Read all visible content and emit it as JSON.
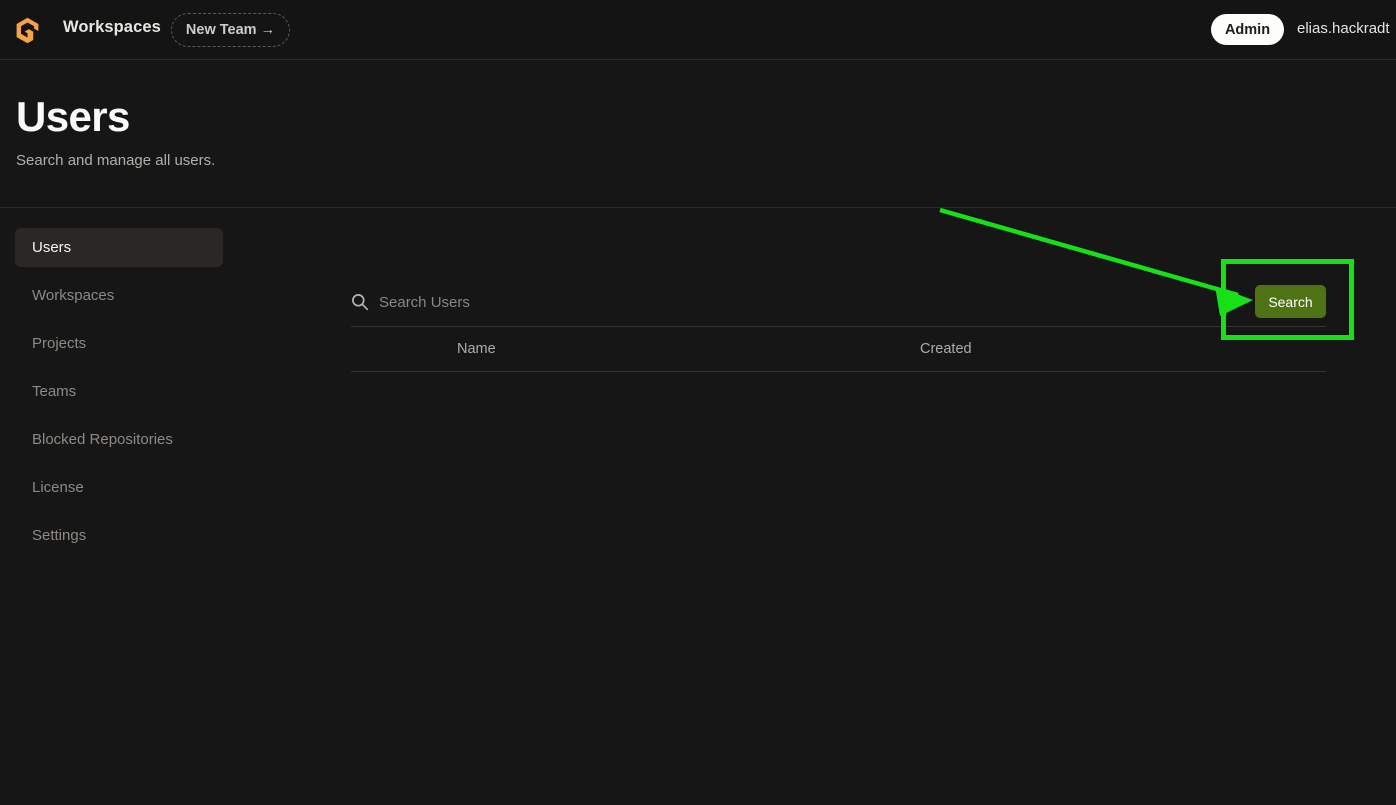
{
  "topbar": {
    "logo_icon": "gitpod-logo-icon",
    "workspaces_label": "Workspaces",
    "new_team_label": "New Team →",
    "admin_badge_label": "Admin",
    "username": "elias.hackradt"
  },
  "page": {
    "title": "Users",
    "subtitle": "Search and manage all users."
  },
  "sidebar": {
    "items": [
      {
        "label": "Users",
        "active": true
      },
      {
        "label": "Workspaces",
        "active": false
      },
      {
        "label": "Projects",
        "active": false
      },
      {
        "label": "Teams",
        "active": false
      },
      {
        "label": "Blocked Repositories",
        "active": false
      },
      {
        "label": "License",
        "active": false
      },
      {
        "label": "Settings",
        "active": false
      }
    ]
  },
  "search": {
    "icon": "search-icon",
    "placeholder": "Search Users",
    "value": "",
    "button_label": "Search"
  },
  "table": {
    "columns": [
      "Name",
      "Created"
    ],
    "rows": []
  },
  "annotation": {
    "color": "#17e017",
    "target": "search-button"
  }
}
